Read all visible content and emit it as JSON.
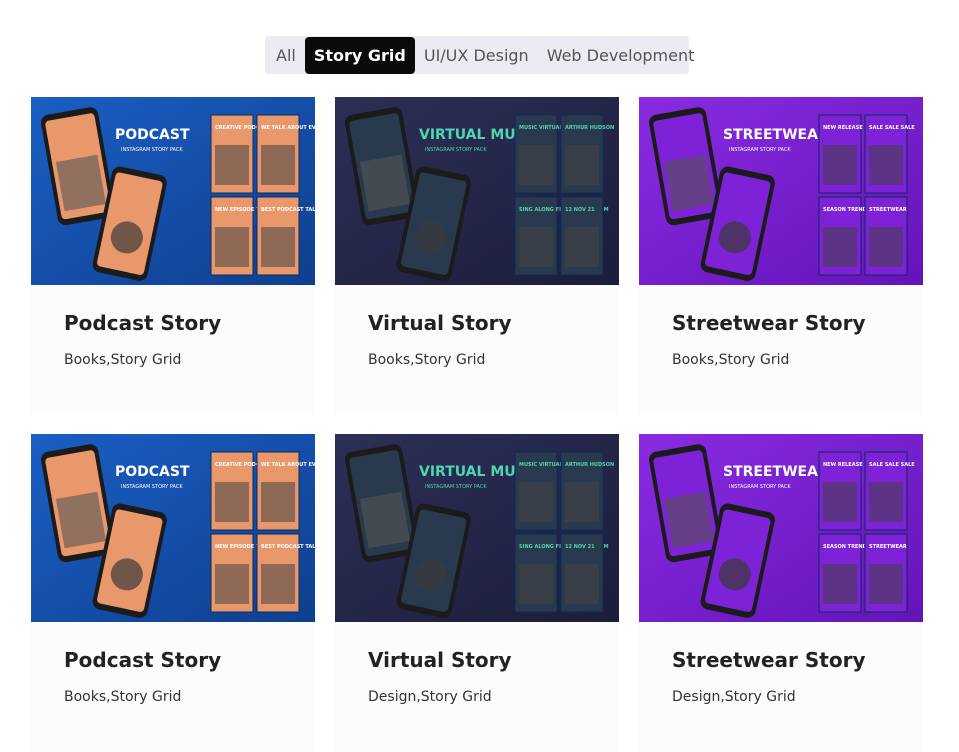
{
  "filters": [
    {
      "label": "All",
      "active": false
    },
    {
      "label": "Story Grid",
      "active": true
    },
    {
      "label": "UI/UX Design",
      "active": false
    },
    {
      "label": "Web Development",
      "active": false
    }
  ],
  "cards": [
    {
      "title": "Podcast Story",
      "tags": "Books,Story Grid",
      "theme": "podcast",
      "headline": "PODCAST",
      "subhead": "INSTAGRAM STORY PACK",
      "phone_text": "CREATIVE PODCAST TALKS",
      "phone_text2": "BEST PODCAST TALKS",
      "tile_text": "CREATIVE PODCAST TALKS",
      "tile_text2": "WE TALK ABOUT EVERYTHING",
      "tile_text3": "NEW EPISODE TODAY",
      "tile_text4": "BEST PODCAST TALKS"
    },
    {
      "title": "Virtual Story",
      "tags": "Books,Story Grid",
      "theme": "virtual",
      "headline": "VIRTUAL MUSIC",
      "subhead": "INSTAGRAM STORY PACK",
      "phone_text": "MUSIC VIRTUAL CONCERT",
      "phone_text2": "",
      "tile_text": "MUSIC VIRTUAL CONCERT",
      "tile_text2": "ARTHUR HUDSON",
      "tile_text3": "SING ALONG FROM YOUR ROOM",
      "tile_text4": "12 NOV 21"
    },
    {
      "title": "Streetwear Story",
      "tags": "Books,Story Grid",
      "theme": "street",
      "headline": "STREETWEAR",
      "subhead": "INSTAGRAM STORY PACK",
      "phone_text": "SALE SALE SALE",
      "phone_text2": "NEW RELEASE",
      "tile_text": "NEW RELEASE",
      "tile_text2": "SALE SALE SALE",
      "tile_text3": "SEASON TREND",
      "tile_text4": "STREETWEAR"
    },
    {
      "title": "Podcast Story",
      "tags": "Books,Story Grid",
      "theme": "podcast",
      "headline": "PODCAST",
      "subhead": "INSTAGRAM STORY PACK",
      "phone_text": "CREATIVE PODCAST TALKS",
      "phone_text2": "BEST PODCAST TALKS",
      "tile_text": "CREATIVE PODCAST TALKS",
      "tile_text2": "WE TALK ABOUT EVERYTHING",
      "tile_text3": "NEW EPISODE TODAY",
      "tile_text4": "BEST PODCAST TALKS"
    },
    {
      "title": "Virtual Story",
      "tags": "Design,Story Grid",
      "theme": "virtual",
      "headline": "VIRTUAL MUSIC",
      "subhead": "INSTAGRAM STORY PACK",
      "phone_text": "MUSIC VIRTUAL CONCERT",
      "phone_text2": "",
      "tile_text": "MUSIC VIRTUAL CONCERT",
      "tile_text2": "ARTHUR HUDSON",
      "tile_text3": "SING ALONG FROM YOUR ROOM",
      "tile_text4": "12 NOV 21"
    },
    {
      "title": "Streetwear Story",
      "tags": "Design,Story Grid",
      "theme": "street",
      "headline": "STREETWEAR",
      "subhead": "INSTAGRAM STORY PACK",
      "phone_text": "SALE SALE SALE",
      "phone_text2": "NEW RELEASE",
      "tile_text": "NEW RELEASE",
      "tile_text2": "SALE SALE SALE",
      "tile_text3": "SEASON TREND",
      "tile_text4": "STREETWEAR"
    }
  ],
  "themes": {
    "podcast": {
      "bg1": "#1a5fc4",
      "bg2": "#0f3f8f",
      "panel": "#e9986c",
      "accent": "#ffffff",
      "text": "#ffffff"
    },
    "virtual": {
      "bg1": "#2d2f57",
      "bg2": "#1c1d3a",
      "panel": "#2a3a4e",
      "accent": "#4ed6b0",
      "text": "#4ed6b0"
    },
    "street": {
      "bg1": "#8a2be2",
      "bg2": "#6314b8",
      "panel": "#7d22d6",
      "accent": "#ffffff",
      "text": "#ffffff"
    }
  }
}
